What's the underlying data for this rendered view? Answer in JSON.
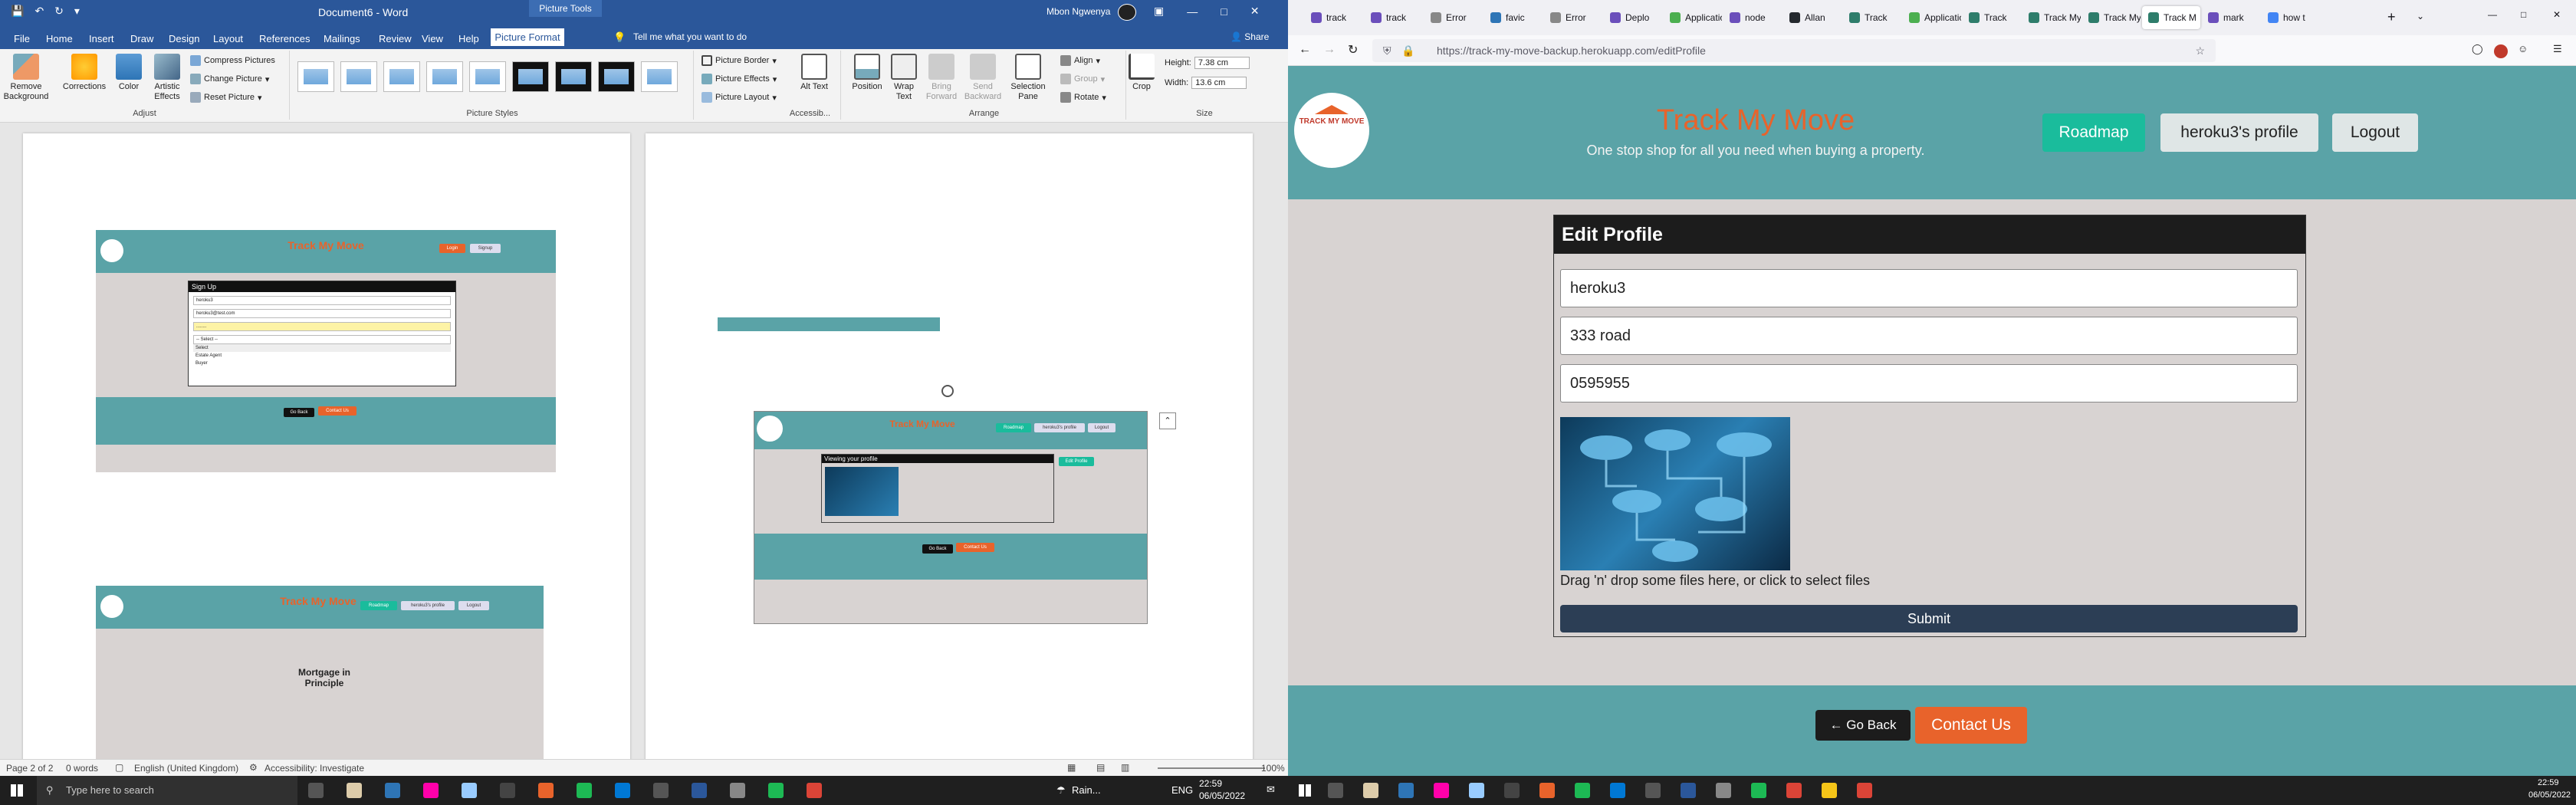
{
  "word": {
    "title_left": "Document6 - Word",
    "context_tab": "Picture Tools",
    "user": "Mbon Ngwenya",
    "tabs": [
      "File",
      "Home",
      "Insert",
      "Draw",
      "Design",
      "Layout",
      "References",
      "Mailings",
      "Review",
      "View",
      "Help",
      "Picture Format"
    ],
    "tell_me": "Tell me what you want to do",
    "share": "Share",
    "ribbon": {
      "remove_bg": "Remove Background",
      "corrections": "Corrections",
      "color": "Color",
      "artistic": "Artistic Effects",
      "compress": "Compress Pictures",
      "change": "Change Picture",
      "reset": "Reset Picture",
      "adjust_label": "Adjust",
      "styles_label": "Picture Styles",
      "border": "Picture Border",
      "effects": "Picture Effects",
      "layout": "Picture Layout",
      "alt_text": "Alt Text",
      "access_label": "Accessib...",
      "position": "Position",
      "wrap": "Wrap Text",
      "bring": "Bring Forward",
      "send": "Send Backward",
      "selection": "Selection Pane",
      "align": "Align",
      "group": "Group",
      "rotate": "Rotate",
      "arrange_label": "Arrange",
      "crop": "Crop",
      "height_label": "Height:",
      "height_val": "7.38 cm",
      "width_label": "Width:",
      "width_val": "13.6 cm",
      "size_label": "Size"
    },
    "thumbs": {
      "brand": "Track My Move",
      "signup_head": "Sign Up",
      "signup_fields": [
        "heroku3",
        "heroku3@test.com",
        "........",
        "-- Select --"
      ],
      "signup_opts": [
        "Select",
        "Estate Agent",
        "Buyer"
      ],
      "login": "Login",
      "signup": "Signup",
      "roadmap": "Roadmap",
      "profile": "heroku3's profile",
      "logout": "Logout",
      "viewing": "Viewing your profile",
      "edit": "Edit Profile",
      "mortgage": "Mortgage in Principle",
      "go_back": "Go Back",
      "contact": "Contact Us"
    },
    "status": {
      "page": "Page 2 of 2",
      "words": "0 words",
      "lang": "English (United Kingdom)",
      "access": "Accessibility: Investigate",
      "zoom": "100%"
    }
  },
  "taskbar_left": {
    "search": "Type here to search",
    "weather": "Rain...",
    "lang": "ENG",
    "time": "22:59",
    "date": "06/05/2022"
  },
  "taskbar_right": {
    "time": "22:59",
    "date": "06/05/2022"
  },
  "browser": {
    "tabs": [
      "track",
      "track",
      "Error",
      "favic",
      "Error",
      "Deplo",
      "Applicatio",
      "node",
      "Allan",
      "Track",
      "Applicatio",
      "Track",
      "Track My",
      "Track My",
      "Track M",
      "mark",
      "how t"
    ],
    "url": "https://track-my-move-backup.herokuapp.com/editProfile"
  },
  "site": {
    "logo_text": "TRACK MY MOVE",
    "title": "Track My Move",
    "subtitle": "One stop shop for all you need when buying a property.",
    "nav": {
      "roadmap": "Roadmap",
      "profile": "heroku3's profile",
      "logout": "Logout"
    },
    "card_title": "Edit Profile",
    "fields": {
      "name": "heroku3",
      "address": "333 road",
      "phone": "0595955"
    },
    "dropzone": "Drag 'n' drop some files here, or click to select files",
    "submit": "Submit",
    "footer": {
      "back": "← Go Back",
      "contact": "Contact Us"
    }
  },
  "colors": {
    "teal": "#5aa3a7",
    "orange": "#e8632b",
    "word_blue": "#2b579a",
    "page_bg": "#d8d3d2"
  }
}
